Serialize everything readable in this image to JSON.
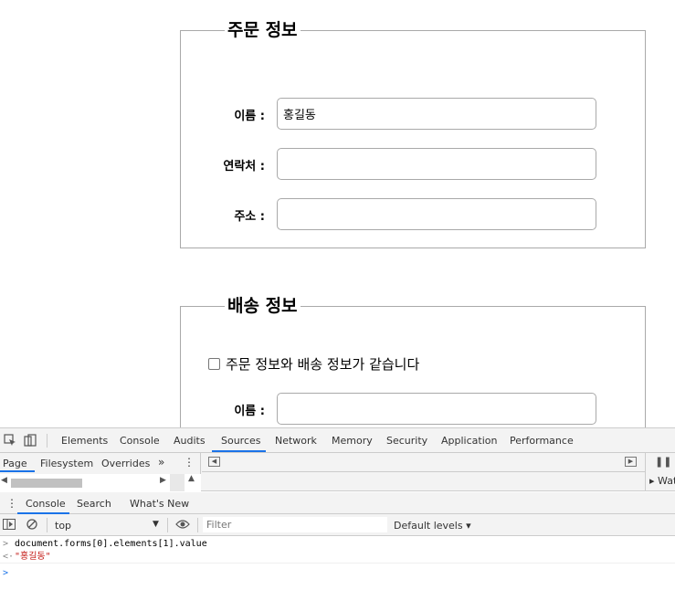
{
  "order_info": {
    "legend": "주문 정보",
    "fields": [
      {
        "label": "이름 :",
        "value": "홍길동"
      },
      {
        "label": "연락처 :",
        "value": ""
      },
      {
        "label": "주소 :",
        "value": ""
      }
    ]
  },
  "shipping_info": {
    "legend": "배송 정보",
    "same_checkbox_label": "주문 정보와 배송 정보가 같습니다",
    "same_checked": false,
    "fields": [
      {
        "label": "이름 :",
        "value": ""
      }
    ]
  },
  "devtools": {
    "main_tabs": [
      "Elements",
      "Console",
      "Audits",
      "Sources",
      "Network",
      "Memory",
      "Security",
      "Application",
      "Performance"
    ],
    "active_main_tab": "Sources",
    "sources_tabs": [
      "Page",
      "Filesystem",
      "Overrides"
    ],
    "more_tabs": "»",
    "watch_label": "Wat",
    "drawer_tabs": [
      "Console",
      "Search",
      "What's New"
    ],
    "context": "top",
    "filter_placeholder": "Filter",
    "levels": "Default levels ▾",
    "console_lines": [
      {
        "type": "input",
        "prefix": ">",
        "text": "document.forms[0].elements[1].value"
      },
      {
        "type": "result",
        "prefix": "<·",
        "text": "\"홍길동\""
      },
      {
        "type": "prompt",
        "prefix": ">",
        "text": ""
      }
    ]
  }
}
